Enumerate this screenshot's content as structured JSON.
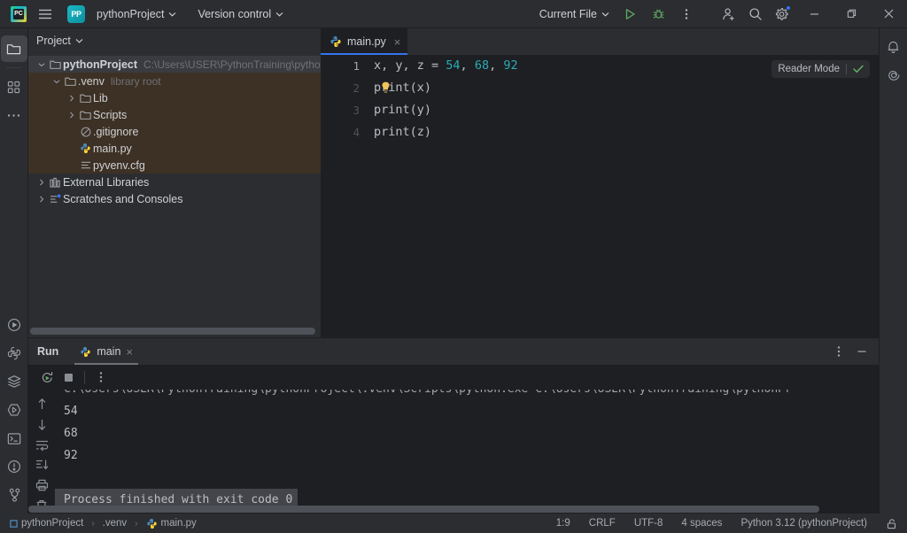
{
  "titlebar": {
    "app_icon": "pycharm-logo-icon",
    "menu_icon": "hamburger-menu-icon",
    "project_badge": "PP",
    "project_name": "pythonProject",
    "version_control": "Version control",
    "run_config": "Current File",
    "run_icon": "run-icon",
    "debug_icon": "debug-icon",
    "more_icon": "more-vertical-icon",
    "account_icon": "add-account-icon",
    "search_icon": "search-icon",
    "settings_icon": "gear-icon",
    "minimize": "minimize-icon",
    "maximize": "maximize-icon",
    "close": "close-icon"
  },
  "left_rail": {
    "top": [
      {
        "name": "project-tool-window",
        "icon": "folder-icon",
        "active": true
      },
      {
        "name": "commit-tool-window",
        "icon": "commit-grid-icon",
        "active": false
      },
      {
        "name": "more-tool-windows",
        "icon": "ellipsis-icon",
        "active": false
      }
    ],
    "bottom": [
      {
        "name": "run-tool-window",
        "icon": "run-triangle-icon"
      },
      {
        "name": "python-packages",
        "icon": "python-icon"
      },
      {
        "name": "database-tool-window",
        "icon": "database-layers-icon"
      },
      {
        "name": "python-console",
        "icon": "python-console-icon"
      },
      {
        "name": "terminal-tool-window",
        "icon": "terminal-icon"
      },
      {
        "name": "problems-tool-window",
        "icon": "warning-circle-icon"
      },
      {
        "name": "version-control-tool-window",
        "icon": "branch-icon"
      }
    ]
  },
  "right_rail": {
    "items": [
      {
        "name": "notifications",
        "icon": "bell-icon"
      },
      {
        "name": "ai-assistant",
        "icon": "ai-spiral-icon"
      }
    ]
  },
  "project_panel": {
    "header": "Project",
    "header_chevron": "chevron-down-icon",
    "tree": [
      {
        "id": "pythonProject",
        "label": "pythonProject",
        "sub": "C:\\Users\\USER\\PythonTraining\\pythonProject",
        "indent": 0,
        "twist": "expanded",
        "icon": "folder-icon",
        "state": "selected",
        "bold": true
      },
      {
        "id": "venv",
        "label": ".venv",
        "sub": "library root",
        "indent": 1,
        "twist": "expanded",
        "icon": "folder-icon",
        "state": "highlight",
        "bold": false
      },
      {
        "id": "lib",
        "label": "Lib",
        "sub": "",
        "indent": 2,
        "twist": "collapsed",
        "icon": "folder-icon",
        "state": "highlight",
        "bold": false
      },
      {
        "id": "scripts",
        "label": "Scripts",
        "sub": "",
        "indent": 2,
        "twist": "collapsed",
        "icon": "folder-icon",
        "state": "highlight",
        "bold": false
      },
      {
        "id": "gitignore",
        "label": ".gitignore",
        "sub": "",
        "indent": 2,
        "twist": "none",
        "icon": "ignored-file-icon",
        "state": "highlight",
        "bold": false
      },
      {
        "id": "mainpy",
        "label": "main.py",
        "sub": "",
        "indent": 2,
        "twist": "none",
        "icon": "python-file-icon",
        "state": "highlight",
        "bold": false
      },
      {
        "id": "pyvenvcfg",
        "label": "pyvenv.cfg",
        "sub": "",
        "indent": 2,
        "twist": "none",
        "icon": "config-file-icon",
        "state": "highlight",
        "bold": false
      },
      {
        "id": "extlibs",
        "label": "External Libraries",
        "sub": "",
        "indent": 0,
        "twist": "collapsed",
        "icon": "library-icon",
        "state": "none",
        "bold": false
      },
      {
        "id": "scratches",
        "label": "Scratches and Consoles",
        "sub": "",
        "indent": 0,
        "twist": "collapsed",
        "icon": "scratches-icon",
        "state": "none",
        "bold": false
      }
    ]
  },
  "editor": {
    "tab_label": "main.py",
    "tab_icon": "python-file-icon",
    "tab_close": "close-icon",
    "reader_mode_label": "Reader Mode",
    "reader_mode_check": "check-icon",
    "line_numbers": [
      "1",
      "2",
      "3",
      "4"
    ],
    "lines": [
      {
        "n": 1,
        "segments": [
          {
            "t": "x, y, z = ",
            "c": "plain"
          },
          {
            "t": "54",
            "c": "num"
          },
          {
            "t": ", ",
            "c": "plain"
          },
          {
            "t": "68",
            "c": "num"
          },
          {
            "t": ", ",
            "c": "plain"
          },
          {
            "t": "92",
            "c": "num"
          }
        ]
      },
      {
        "n": 2,
        "segments": [
          {
            "t": "print(x)",
            "c": "plain"
          }
        ]
      },
      {
        "n": 3,
        "segments": [
          {
            "t": "print(y)",
            "c": "plain"
          }
        ]
      },
      {
        "n": 4,
        "segments": [
          {
            "t": "print(z)",
            "c": "plain"
          }
        ]
      }
    ],
    "intention_bulb": "lightbulb-icon"
  },
  "run_panel": {
    "title": "Run",
    "tab_label": "main",
    "tab_icon": "python-file-icon",
    "tab_close": "close-icon",
    "rerun_icon": "rerun-icon",
    "stop_icon": "stop-icon",
    "more_icon": "more-vertical-icon",
    "options_icon": "more-vertical-icon",
    "hide_icon": "minimize-icon",
    "side_buttons": [
      {
        "name": "up-arrow-icon"
      },
      {
        "name": "down-arrow-icon"
      },
      {
        "name": "soft-wrap-icon"
      },
      {
        "name": "scroll-to-end-icon"
      },
      {
        "name": "print-icon"
      },
      {
        "name": "clear-all-icon"
      }
    ],
    "console_lines": [
      "C:\\Users\\USER\\PythonTraining\\pythonProject\\.venv\\Scripts\\python.exe C:\\Users\\USER\\PythonTraining\\pythonPr",
      "54",
      "68",
      "92",
      "",
      "Process finished with exit code 0"
    ]
  },
  "status_bar": {
    "breadcrumbs": [
      {
        "label": "pythonProject",
        "icon": "project-square-icon"
      },
      {
        "label": ".venv",
        "icon": "none"
      },
      {
        "label": "main.py",
        "icon": "python-file-icon"
      }
    ],
    "caret": "1:9",
    "line_sep": "CRLF",
    "encoding": "UTF-8",
    "indent": "4 spaces",
    "interpreter": "Python 3.12 (pythonProject)",
    "lock_icon": "unlocked-icon"
  },
  "colors": {
    "bg_editor": "#1e1f22",
    "bg_chrome": "#2b2d30",
    "accent_blue": "#3574f0",
    "highlight_brown": "#3d3125",
    "selection_gray": "#393b40",
    "number_cyan": "#2aacb8",
    "run_green": "#5fad65"
  }
}
